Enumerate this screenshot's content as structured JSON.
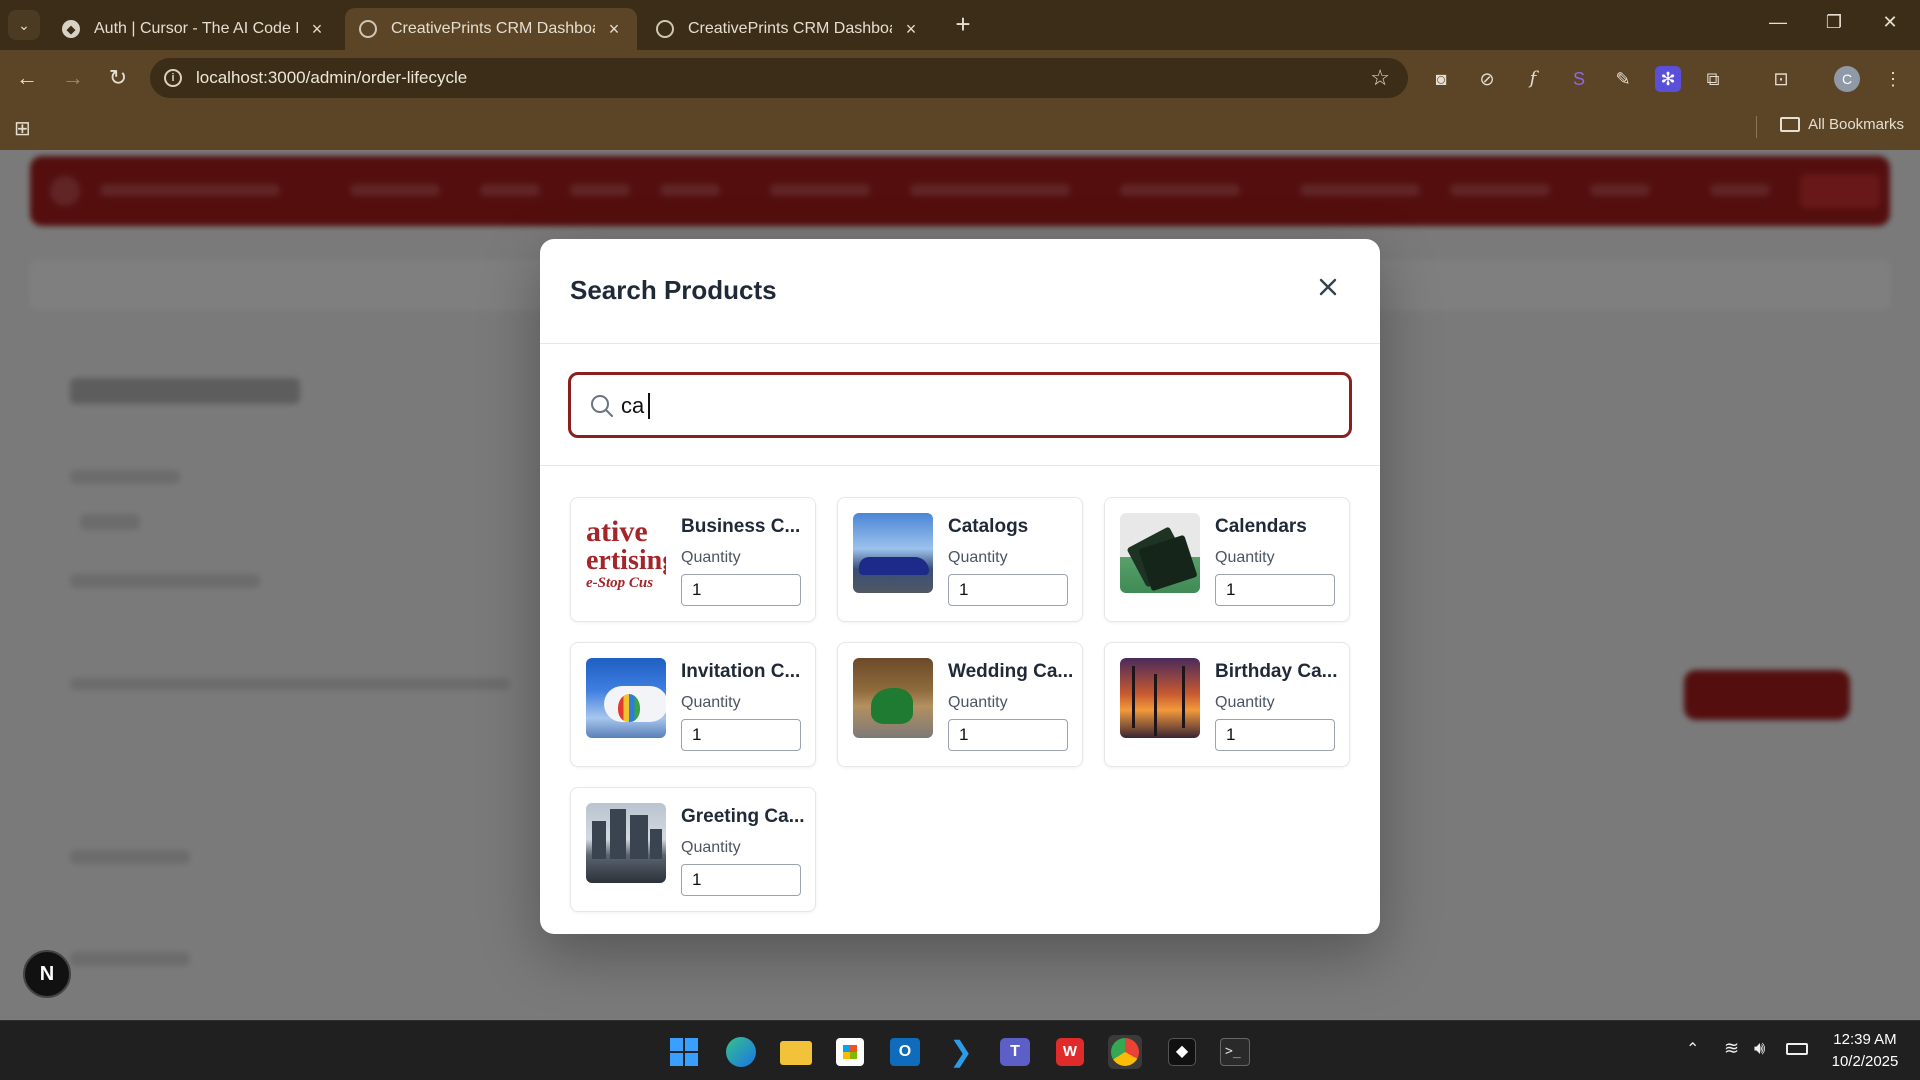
{
  "browser": {
    "tabs": [
      {
        "title": "Auth | Cursor - The AI Code Edi",
        "active": false
      },
      {
        "title": "CreativePrints CRM Dashboard",
        "active": true
      },
      {
        "title": "CreativePrints CRM Dashboard",
        "active": false
      }
    ],
    "url": "localhost:3000/admin/order-lifecycle",
    "bookmarks_label": "All Bookmarks",
    "profile_initial": "C"
  },
  "modal": {
    "title": "Search Products",
    "search_value": "ca",
    "quantity_label": "Quantity",
    "products": [
      {
        "name": "Business C...",
        "quantity": "1",
        "thumb": "business-cards-thumb"
      },
      {
        "name": "Catalogs",
        "quantity": "1",
        "thumb": "car-photo-thumb"
      },
      {
        "name": "Calendars",
        "quantity": "1",
        "thumb": "black-cards-thumb"
      },
      {
        "name": "Invitation C...",
        "quantity": "1",
        "thumb": "hot-air-balloon-thumb"
      },
      {
        "name": "Wedding Ca...",
        "quantity": "1",
        "thumb": "motorcycle-thumb"
      },
      {
        "name": "Birthday Ca...",
        "quantity": "1",
        "thumb": "palm-sunset-thumb"
      },
      {
        "name": "Greeting Ca...",
        "quantity": "1",
        "thumb": "city-skyline-thumb"
      }
    ],
    "business_thumb_text": [
      "ative",
      "ertising",
      "e-Stop Cus"
    ]
  },
  "dev_badge": "N",
  "colors": {
    "accent": "#8b1e1e",
    "header_red": "#a81d1d",
    "chrome_dark": "#3b2d17",
    "chrome": "#5b4526"
  },
  "taskbar": {
    "time": "12:39 AM",
    "date": "10/2/2025"
  }
}
